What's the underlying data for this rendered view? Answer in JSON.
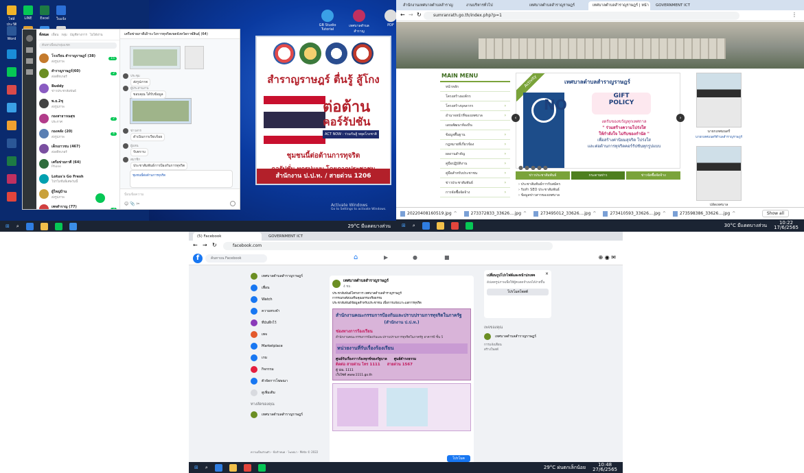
{
  "panel1": {
    "desktop_icons": [
      {
        "label": "ไฟล์ประวัติ",
        "color": "#f0b429"
      },
      {
        "label": "LINE",
        "color": "#06c755"
      },
      {
        "label": "Excel",
        "color": "#1d7a44"
      },
      {
        "label": "ใบแจ้ง",
        "color": "#2b6fd6"
      },
      {
        "label": "Word",
        "color": "#2b5797"
      },
      {
        "label": "ไฟล์",
        "color": "#e0a030"
      },
      {
        "label": "ระบบ",
        "color": "#3a8ee6"
      },
      {
        "label": "งาน",
        "color": "#d9d9d9"
      }
    ],
    "top_right_icons": [
      {
        "label": "GB Studio Tutorial",
        "color": "#3aa0e6"
      },
      {
        "label": "เทศบาลตำบล สำราญ",
        "color": "#c03060"
      },
      {
        "label": "PDF",
        "color": "#dddddd"
      }
    ],
    "line": {
      "tabs": [
        "ทั้งหมด",
        "เพื่อน",
        "กลุ่ม",
        "บัญชีทางการ",
        "ไม่ได้อ่าน"
      ],
      "search_placeholder": "ค้นหาเพื่อน/กลุ่มแชท",
      "chat_title": "เครือข่ายภาคีเฝ้าระวังการทุจริตเขตจังหวัดกาฬสินธุ์ (64)",
      "chats": [
        {
          "name": "โรงเรียน สำราญราษฎร์ (38)",
          "preview": "ส่งรูปภาพ",
          "badge": "15",
          "color": "#c47a2c"
        },
        {
          "name": "สำราญราษฎร์(60)",
          "preview": "ส่งสติกเกอร์",
          "badge": "2",
          "color": "#6b8e23"
        },
        {
          "name": "Buddy",
          "preview": "ข่าวประชาสัมพันธ์",
          "badge": "",
          "color": "#8a5cc2"
        },
        {
          "name": "พ.ย.2ชุ",
          "preview": "ส่งรูปภาพ",
          "badge": "",
          "color": "#444444"
        },
        {
          "name": "กองสาธารณสุข",
          "preview": "ประกาศ",
          "badge": "2",
          "color": "#b23c8a"
        },
        {
          "name": "กองคลัง (20)",
          "preview": "ส่งรูปภาพ",
          "badge": "4",
          "color": "#5a7fb3"
        },
        {
          "name": "เด็กเยาวชน (467)",
          "preview": "ส่งสติกเกอร์",
          "badge": "",
          "color": "#7a4fa0"
        },
        {
          "name": "เครือข่ายภาคี (64)",
          "preview": "Phone",
          "badge": "",
          "color": "#2f6d3d"
        },
        {
          "name": "Lotus's Go Fresh",
          "preview": "โปรโมชั่นพิเศษวันนี้",
          "badge": "",
          "color": "#00a0b0"
        },
        {
          "name": "ผู้ใหญ่บ้าน",
          "preview": "ส่งรูปภาพ",
          "badge": "",
          "color": "#c9a13a"
        },
        {
          "name": "เพจสำราญ (77)",
          "preview": "ส่งรูปภาพ",
          "badge": "3",
          "color": "#d04040"
        }
      ],
      "messages": [
        {
          "sender": "ประชุม",
          "text": "ส่งรูปภาพ"
        },
        {
          "sender": "ผู้ประสานงาน",
          "text": "ขอบคุณ ได้รับข้อมูล"
        },
        {
          "sender": "ข่าวสาร",
          "text": "ดำเนินการเรียบร้อย"
        },
        {
          "sender": "ผู้แทน",
          "text": "รับทราบ"
        },
        {
          "sender": "สมาชิก",
          "text": "ประชาสัมพันธ์การป้องกันการทุจริต"
        }
      ],
      "composer_placeholder": "ป้อนข้อความ"
    },
    "poster": {
      "line1": "สำราญราษฎร์ ตื่นรู้ สู้โกง",
      "line2": "ต่อต้าน",
      "line3": "คอร์รัปชัน",
      "slogan_small": "ACT NOW : ร่วมกันสู้ หยุดโกงชาติ",
      "line4": "ชุมชนนี้ต่อต้านการทุจริต",
      "line5": "คอรัปชั่น ทุกรูปแบบ โดยภาคประชาชน",
      "hotline": "สำนักงาน ป.ป.ท. / สายด่วน 1206"
    },
    "taskbar_weather": "29°C มีแดดบางส่วน",
    "activate": "Activate Windows",
    "activate_sub": "Go to Settings to activate Windows."
  },
  "panel2": {
    "tabs": [
      "สำนักงานเทศบาลตำบลสำราญ",
      "งานบริหารทั่วไป",
      "เทศบาลตำบลสำราญราษฎร์",
      "เทศบาลตำบลสำราญราษฎร์ | หน้า",
      "GOVERNMENT ICT"
    ],
    "url": "sumranrath.go.th/index.php?p=1",
    "menu_title": "MAIN MENU",
    "menu_items": [
      "หน้าหลัก",
      "โครงสร้างองค์กร",
      "โครงสร้างบุคลากร",
      "อำนาจหน้าที่ของเทศบาล",
      "แผนพัฒนาท้องถิ่น",
      "ข้อมูลพื้นฐาน",
      "กฎหมายที่เกี่ยวข้อง",
      "ผลงานสำคัญ",
      "คู่มือปฏิบัติงาน",
      "คู่มือสำหรับประชาชน",
      "ข่าวประชาสัมพันธ์",
      "การจัดซื้อจัดจ้าง"
    ],
    "banner": {
      "badge": "Activity",
      "org": "เทศบาลตำบลสำราญราษฎร์",
      "no": "NO",
      "gift1": "GIFT",
      "gift2": "POLICY",
      "text1": "งดรับของขวัญทุกเทศกาล",
      "text2": "\" ร่วมสร้างความโปร่งใส",
      "text3": "ให้กำลังใจ ไม่รับของกำนัล \"",
      "text4": "เพื่อสร้างค่านิยมสุจริต โปร่งใส",
      "text5": "และต่อต้านการทุจริตคอร์รัปชันทุกรูปแบบ"
    },
    "news_tabs": [
      "ข่าวประชาสัมพันธ์",
      "กระดานข่าว",
      "ข่าวจัดซื้อจัดจ้าง"
    ],
    "news_items": [
      "ประชาสัมพันธ์การรับสมัคร",
      "รับทำ SEO ประชาสัมพันธ์",
      "ข้อมูลข่าวสารของเทศบาล"
    ],
    "people": [
      {
        "name": "นายกเทศมนตรี",
        "role": "นายกเทศมนตรีตำบลสำราญราษฎร์"
      },
      {
        "name": "ปลัดเทศบาล",
        "role": "ปลัดเทศบาล"
      }
    ],
    "downloads": [
      "20220408160519.jpg",
      "273372833_33626....jpg",
      "273495012_33626....jpg",
      "273410593_33626....jpg",
      "273598386_33626....jpg"
    ],
    "show_all": "Show all",
    "taskbar_weather": "30°C มีแดดบางส่วน",
    "time": "10:22",
    "date": "17/6/2565"
  },
  "panel3": {
    "tabs": [
      "(5) Facebook",
      "GOVERNMENT ICT"
    ],
    "url": "facebook.com",
    "search_placeholder": "ค้นหาบน Facebook",
    "sidebar": [
      {
        "label": "เทศบาลตำบลสำราญราษฎร์",
        "color": "#6b8e23"
      },
      {
        "label": "เพื่อน",
        "color": "#1877f2"
      },
      {
        "label": "Watch",
        "color": "#1877f2"
      },
      {
        "label": "ความทรงจำ",
        "color": "#1877f2"
      },
      {
        "label": "ที่บันทึกไว้",
        "color": "#8a3ab9"
      },
      {
        "label": "เพจ",
        "color": "#e3592c"
      },
      {
        "label": "Marketplace",
        "color": "#1877f2"
      },
      {
        "label": "เกม",
        "color": "#1877f2"
      },
      {
        "label": "กิจกรรม",
        "color": "#e41e3f"
      },
      {
        "label": "ตัวจัดการโฆษณา",
        "color": "#1877f2"
      },
      {
        "label": "ดูเพิ่มเติม",
        "color": "#d8dadf"
      }
    ],
    "shortcuts_title": "ทางลัดของคุณ",
    "shortcut": "เทศบาลตำบลสำราญราษฎร์",
    "post": {
      "page": "เทศบาลตำบลสำราญราษฎร์",
      "time": "4 ชม.",
      "text1": "ประชาสัมพันธ์โครงการ เทศบาลตำบลสำราญราษฎร์",
      "text2": "การรณรงค์ส่งเสริมคุณธรรมจริยธรรม",
      "text3": "ประชาสัมพันธ์ข้อมูลสำหรับประชาชน เพื่อการแจ้งเบาะแสการทุจริต",
      "box_title": "สำนักงานคณะกรรมการป้องกันและปราบปรามการทุจริตในภาครัฐ",
      "box_sub": "(สำนักงาน ป.ป.ท.)",
      "item1": "ช่องทางการร้องเรียน",
      "item1_desc": "สำนักงานคณะกรรมการป้องกันและปราบปรามการทุจริตในภาครัฐ อาคารบี ชั้น 5",
      "section": "หน่วยงานที่รับเรื่องร้องเรียน",
      "center1": "ศูนย์รับเรื่องราวร้องทุกข์ของรัฐบาล",
      "center2": "ศูนย์ดำรงธรรม",
      "hotline1": "ติดต่อ สายด่วน โทร 1111",
      "hotline2": "สายด่วน 1567",
      "po": "ตู้ ปณ. 1111",
      "web": "เว็บไซต์ www.1111.go.th"
    },
    "ad": {
      "title": "เปลี่ยนรูปโปรไฟล์และหน้าปกเพจ",
      "desc": "อัปเดตรูปภาพเพื่อให้ผู้คนจดจำเพจได้ง่ายขึ้น",
      "button": "โปรโมตโพสต์"
    },
    "your_pages": "เพจของคุณ",
    "page_name": "เทศบาลตำบลสำราญราษฎร์",
    "page_action1": "การแจ้งเตือน",
    "page_action2": "สร้างโพสต์",
    "promote": "โปรโมต",
    "footer": "ความเป็นส่วนตัว · ข้อกำหนด · โฆษณา · Meta © 2022",
    "taskbar_weather": "29°C ฝนตกเล็กน้อย",
    "time": "10:48",
    "date": "27/6/2565"
  }
}
